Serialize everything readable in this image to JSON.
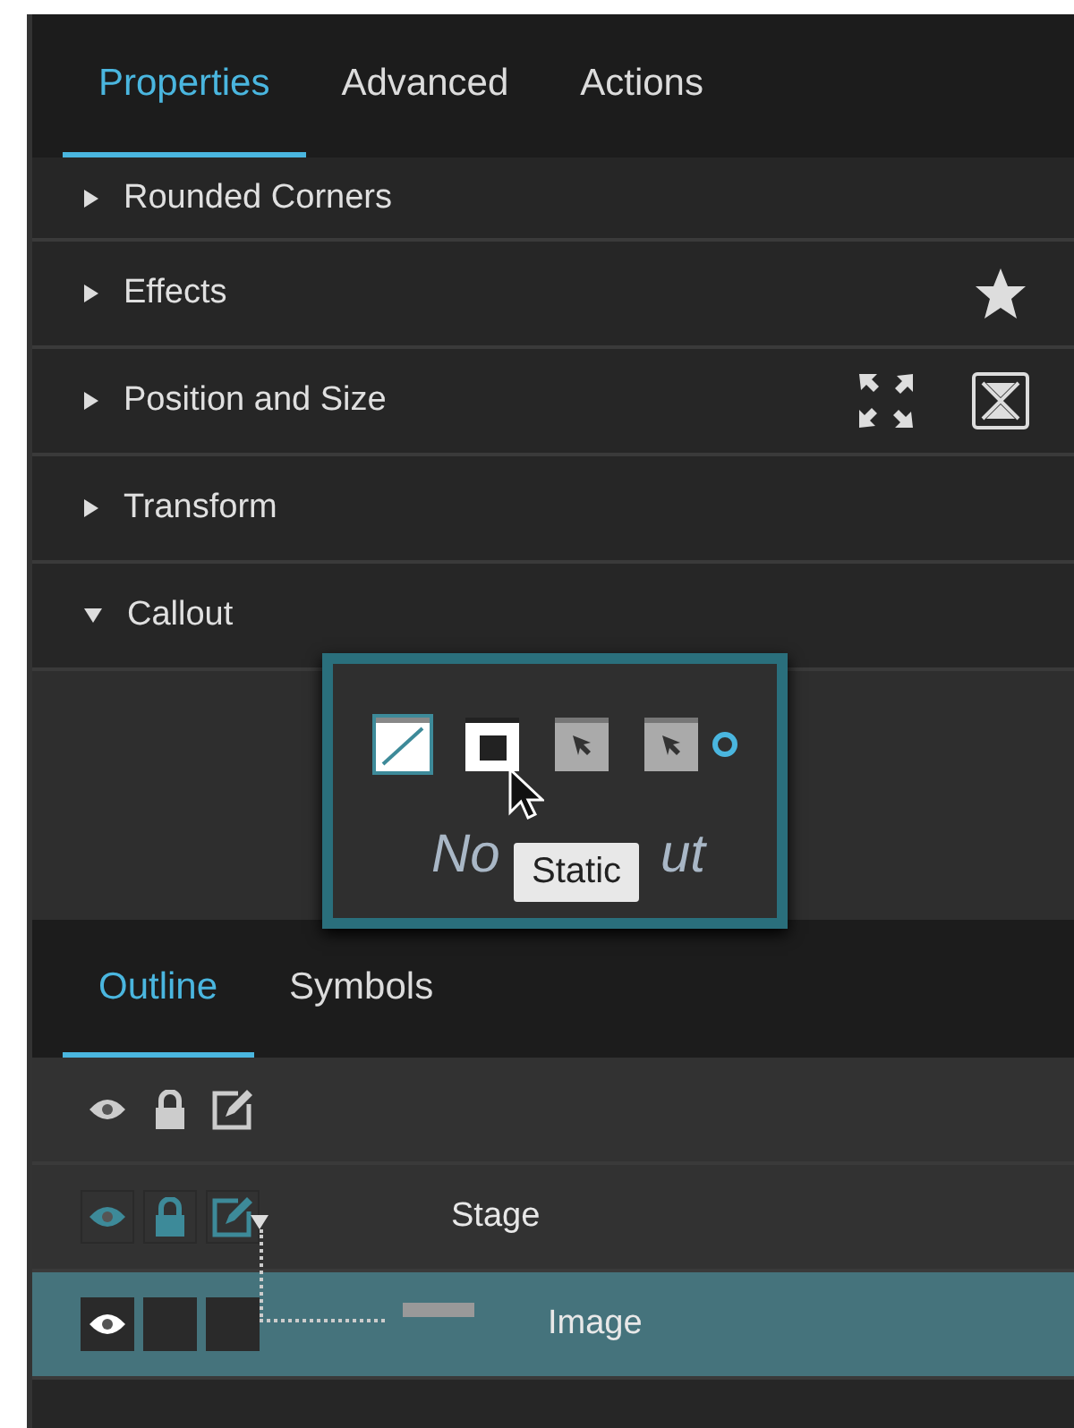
{
  "tabs": [
    {
      "label": "Properties",
      "selected": true
    },
    {
      "label": "Advanced",
      "selected": false
    },
    {
      "label": "Actions",
      "selected": false
    }
  ],
  "sections": [
    {
      "label": "Rounded Corners",
      "expanded": false
    },
    {
      "label": "Effects",
      "expanded": false
    },
    {
      "label": "Position and Size",
      "expanded": false
    },
    {
      "label": "Transform",
      "expanded": false
    },
    {
      "label": "Callout",
      "expanded": true
    }
  ],
  "callout": {
    "options": [
      {
        "kind": "none",
        "selected": true
      },
      {
        "kind": "static",
        "selected": false
      },
      {
        "kind": "pointer",
        "selected": false
      },
      {
        "kind": "pointer",
        "selected": false
      }
    ],
    "label_before": "No",
    "label_after": "ut",
    "tooltip": "Static"
  },
  "outline_tabs": [
    {
      "label": "Outline",
      "selected": true
    },
    {
      "label": "Symbols",
      "selected": false
    }
  ],
  "layers": [
    {
      "label": "Stage",
      "expanded": true,
      "selected": false,
      "children": [
        {
          "label": "Image",
          "selected": true
        }
      ]
    }
  ]
}
